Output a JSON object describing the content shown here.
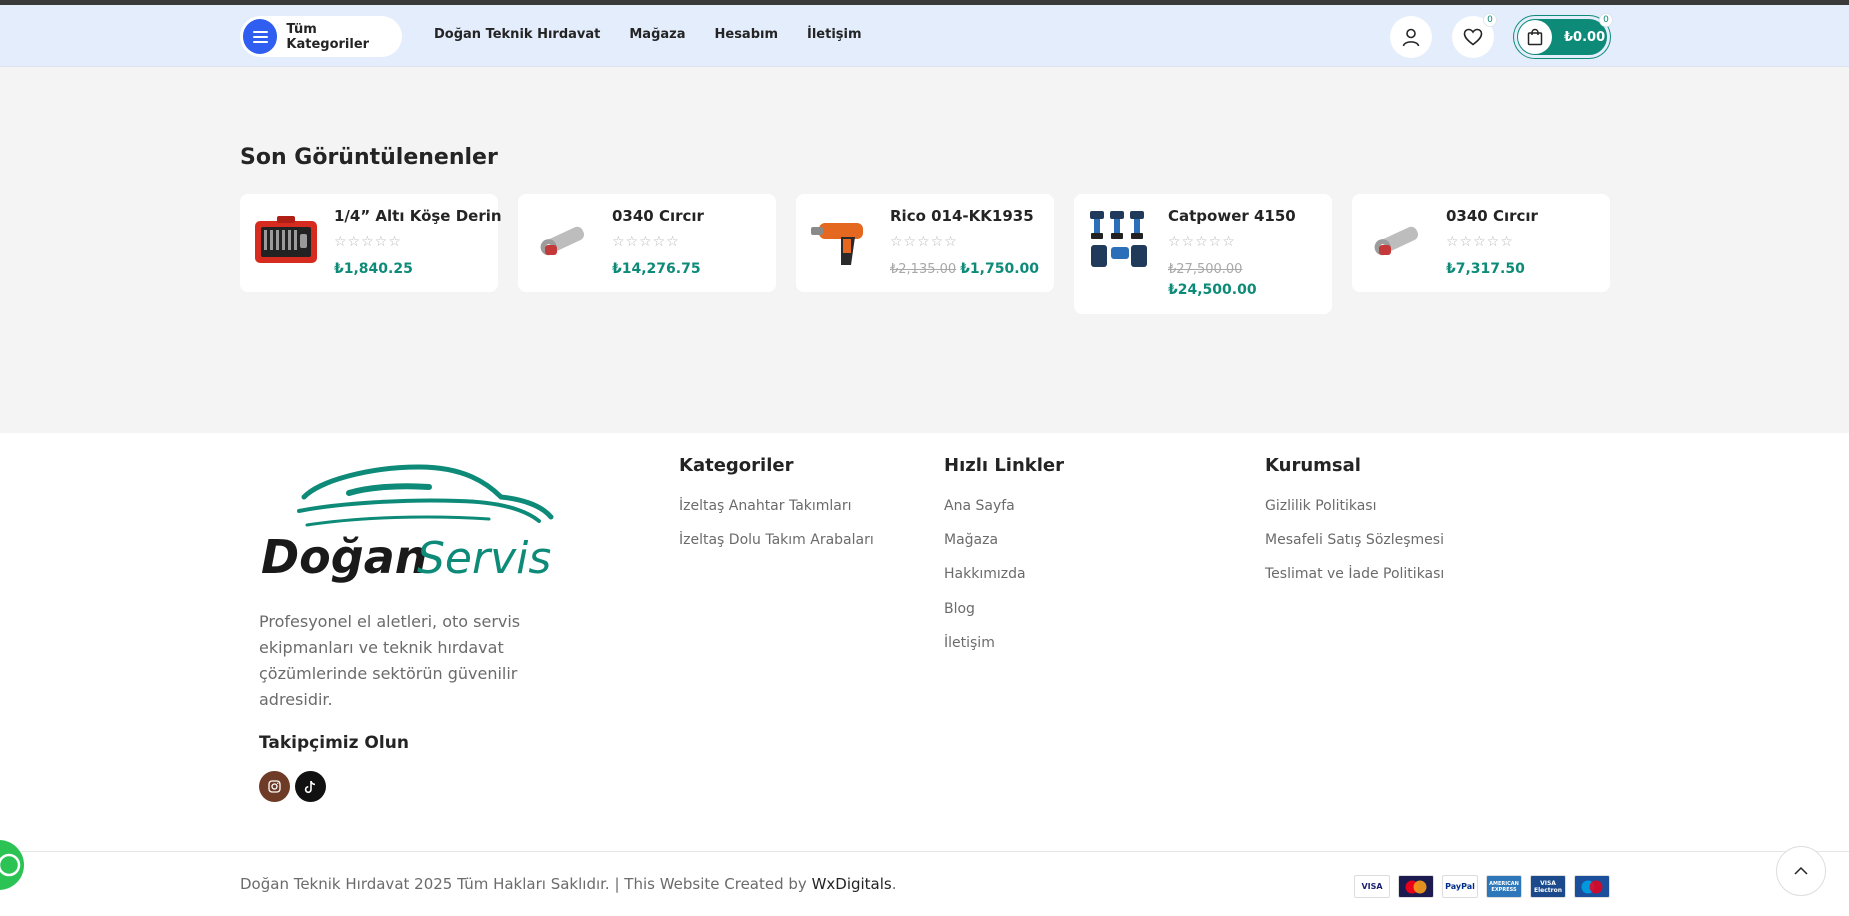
{
  "header": {
    "categories_label": "Tüm Kategoriler",
    "nav": [
      "Doğan Teknik Hırdavat",
      "Mağaza",
      "Hesabım",
      "İletişim"
    ],
    "wishlist_count": "0",
    "cart_count": "0",
    "cart_total": "₺0.00"
  },
  "recent": {
    "title": "Son Görüntülenenler",
    "products": [
      {
        "name": "1/4” Altı Köşe Derin",
        "stars": "☆☆☆☆☆",
        "old_price": "",
        "price": "₺1,840.25",
        "price2": ""
      },
      {
        "name": "0340 Cırcır",
        "stars": "☆☆☆☆☆",
        "old_price": "",
        "price": "₺14,276.75",
        "price2": ""
      },
      {
        "name": "Rico 014-KK1935",
        "stars": "☆☆☆☆☆",
        "old_price": "₺2,135.00",
        "price": "₺1,750.00",
        "price2": ""
      },
      {
        "name": "Catpower 4150",
        "stars": "☆☆☆☆☆",
        "old_price": "₺27,500.00",
        "price": "",
        "price2": "₺24,500.00"
      },
      {
        "name": "0340 Cırcır",
        "stars": "☆☆☆☆☆",
        "old_price": "",
        "price": "₺7,317.50",
        "price2": ""
      }
    ]
  },
  "footer": {
    "logo_bold": "Doğan",
    "logo_light": "Servis",
    "description": "Profesyonel el aletleri, oto servis ekipmanları ve teknik hırdavat çözümlerinde sektörün güvenilir adresidir.",
    "follow_title": "Takipçimiz Olun",
    "columns": [
      {
        "title": "Kategoriler",
        "links": [
          "İzeltaş Anahtar Takımları",
          "İzeltaş Dolu Takım Arabaları"
        ]
      },
      {
        "title": "Hızlı Linkler",
        "links": [
          "Ana Sayfa",
          "Mağaza",
          "Hakkımızda",
          "Blog",
          "İletişim"
        ]
      },
      {
        "title": "Kurumsal",
        "links": [
          "Gizlilik Politikası",
          "Mesafeli Satış Sözleşmesi",
          "Teslimat ve İade Politikası"
        ]
      }
    ],
    "copyright_text": "Doğan Teknik Hırdavat 2025 Tüm Hakları Saklıdır. | This Website Created by ",
    "copyright_brand": "WxDigitals",
    "copyright_end": ".",
    "payments": [
      "VISA",
      "MasterCard",
      "PayPal",
      "AMERICAN EXPRESS",
      "VISA Electron",
      "Maestro"
    ]
  },
  "colors": {
    "accent": "#0e8b78",
    "header_bg": "#e3edfb",
    "category_button": "#2f5ef0"
  },
  "icons": [
    "menu-icon",
    "user-icon",
    "heart-icon",
    "bag-icon",
    "instagram-icon",
    "tiktok-icon",
    "chevron-up-icon",
    "whatsapp-icon"
  ]
}
